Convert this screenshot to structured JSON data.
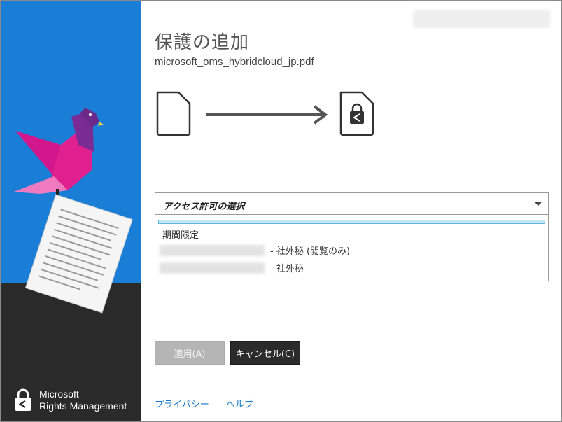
{
  "dialog": {
    "title": "保護の追加",
    "filename": "microsoft_oms_hybridcloud_jp.pdf"
  },
  "brand": {
    "line1": "Microsoft",
    "line2": "Rights Management"
  },
  "permissions": {
    "dropdown_label": "アクセス許可の選択",
    "options": [
      {
        "label": "期間限定"
      },
      {
        "suffix": "- 社外秘 (閲覧のみ)"
      },
      {
        "suffix": "- 社外秘"
      }
    ]
  },
  "buttons": {
    "apply": "適用(A)",
    "cancel": "キャンセル(C)"
  },
  "links": {
    "privacy": "プライバシー",
    "help": "ヘルプ"
  },
  "colors": {
    "sidebar_blue": "#1b7ed6",
    "sidebar_dark": "#2a2a2a",
    "bird_magenta": "#c51a8a",
    "bird_purple": "#6b2a8a",
    "link": "#1a7ac7"
  },
  "icons": [
    "document-icon",
    "arrow-right-icon",
    "locked-document-icon",
    "rights-management-logo-icon",
    "chevron-down-icon"
  ]
}
